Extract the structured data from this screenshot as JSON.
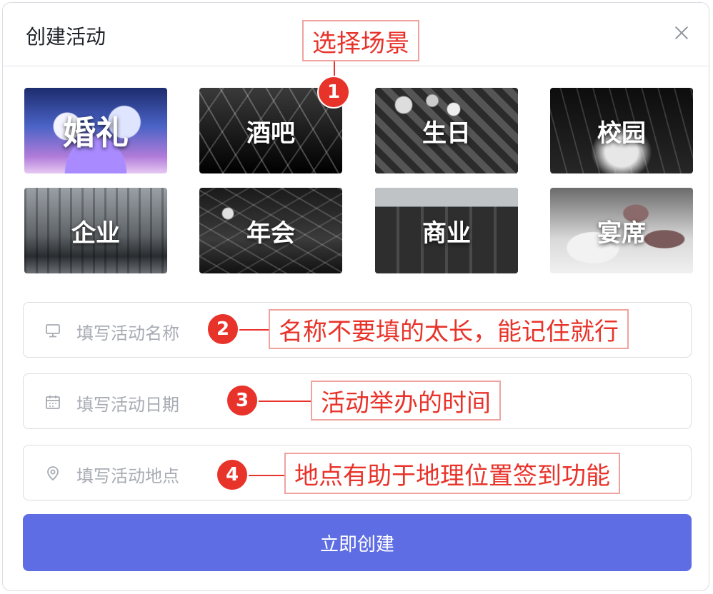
{
  "dialog": {
    "title": "创建活动"
  },
  "scenes": [
    {
      "label": "婚礼"
    },
    {
      "label": "酒吧"
    },
    {
      "label": "生日"
    },
    {
      "label": "校园"
    },
    {
      "label": "企业"
    },
    {
      "label": "年会"
    },
    {
      "label": "商业"
    },
    {
      "label": "宴席"
    }
  ],
  "fields": {
    "name": {
      "placeholder": "填写活动名称",
      "icon": "monitor-icon"
    },
    "date": {
      "placeholder": "填写活动日期",
      "icon": "calendar-icon"
    },
    "location": {
      "placeholder": "填写活动地点",
      "icon": "location-pin-icon"
    }
  },
  "submit_label": "立即创建",
  "annotations": {
    "a1": {
      "number": "1",
      "text": "选择场景"
    },
    "a2": {
      "number": "2",
      "text": "名称不要填的太长，能记住就行"
    },
    "a3": {
      "number": "3",
      "text": "活动举办的时间"
    },
    "a4": {
      "number": "4",
      "text": "地点有助于地理位置签到功能"
    }
  },
  "colors": {
    "accent": "#5e6de3",
    "annotation": "#e8332a",
    "placeholder": "#a7abb3"
  }
}
